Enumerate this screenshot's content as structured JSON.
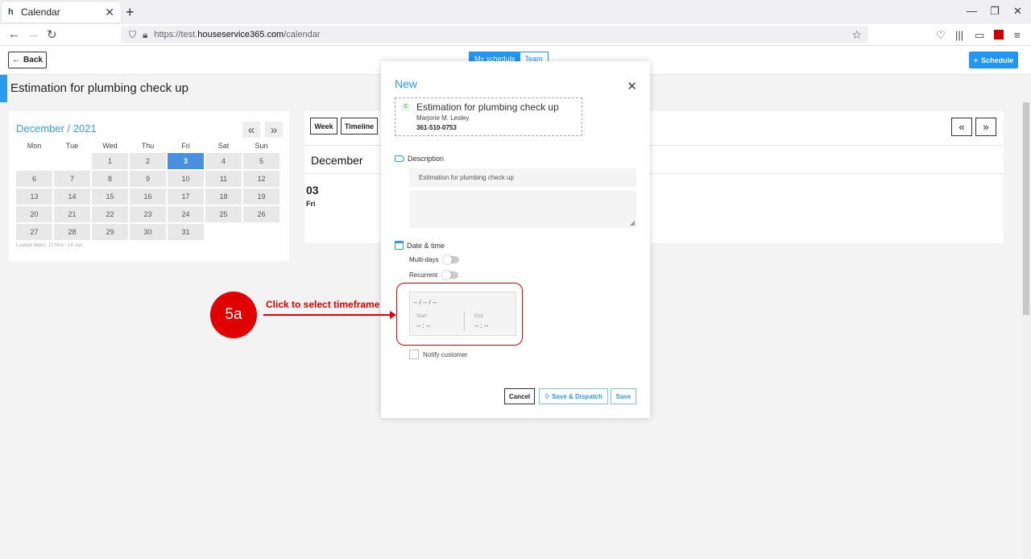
{
  "browser": {
    "tab_title": "Calendar",
    "url_prefix": "https://test.",
    "url_host": "houseservice365.com",
    "url_path": "/calendar"
  },
  "header": {
    "back_label": "Back",
    "toggle_my_schedule": "My schedule",
    "toggle_team": "Team",
    "schedule_label": "Schedule"
  },
  "page_title": "Estimation for plumbing check up",
  "mini_calendar": {
    "title": "December / 2021",
    "prev_icon": "«",
    "next_icon": "»",
    "weekdays": [
      "Mon",
      "Tue",
      "Wed",
      "Thu",
      "Fri",
      "Sat",
      "Sun"
    ],
    "days": [
      "",
      "",
      "1",
      "2",
      "3",
      "4",
      "5",
      "6",
      "7",
      "8",
      "9",
      "10",
      "11",
      "12",
      "13",
      "14",
      "15",
      "16",
      "17",
      "18",
      "19",
      "20",
      "21",
      "22",
      "23",
      "24",
      "25",
      "26",
      "27",
      "28",
      "29",
      "30",
      "31"
    ],
    "selected_day": "3",
    "loaded_dates": "Loaded dates: 17 Nov - 14 Jan"
  },
  "main_calendar": {
    "view_week": "Week",
    "view_timeline": "Timeline",
    "month_title": "December",
    "day_number": "03",
    "day_name": "Fri"
  },
  "modal": {
    "title": "New",
    "job": {
      "badge": "E",
      "title": "Estimation for plumbing check up",
      "customer": "Marjorie M. Lesley",
      "phone": "361-510-0753"
    },
    "description_label": "Description",
    "description_value": "Estimation for plumbing check up",
    "datetime_label": "Date & time",
    "multi_days_label": "Multi-days",
    "recurrent_label": "Recurrent",
    "timeframe": {
      "date": "-- / -- / --",
      "start_label": "Start",
      "start_value": "-- : --",
      "end_label": "End",
      "end_value": "-- : --"
    },
    "notify_label": "Notify customer",
    "cancel_label": "Cancel",
    "dispatch_label": "Save & Dispatch",
    "save_label": "Save"
  },
  "annotation": {
    "step": "5a",
    "text": "Click to select timeframe"
  },
  "colors": {
    "accent": "#2196f3",
    "annotation": "#e00000"
  }
}
